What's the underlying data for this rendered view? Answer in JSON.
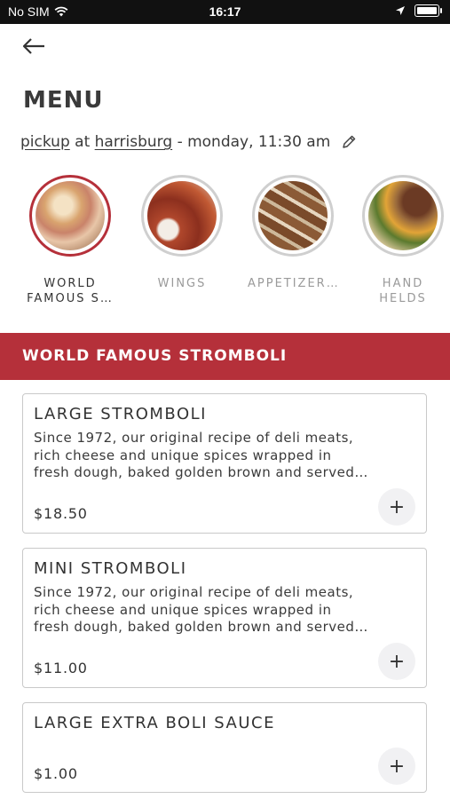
{
  "status_bar": {
    "carrier": "No SIM",
    "time": "16:17"
  },
  "page": {
    "title": "MENU"
  },
  "order": {
    "mode": "pickup",
    "at": "at",
    "location": "harrisburg",
    "time": "- monday, 11:30 am"
  },
  "categories": [
    {
      "label": "WORLD FAMOUS S…",
      "label_lines": [
        "WORLD",
        "FAMOUS S…"
      ],
      "active": true
    },
    {
      "label": "WINGS",
      "label_lines": [
        "WINGS"
      ],
      "active": false
    },
    {
      "label": "APPETIZER…",
      "label_lines": [
        "APPETIZER…"
      ],
      "active": false
    },
    {
      "label": "HAND HELDS",
      "label_lines": [
        "HAND",
        "HELDS"
      ],
      "active": false
    }
  ],
  "section": {
    "title": "WORLD FAMOUS STROMBOLI"
  },
  "items": [
    {
      "name": "LARGE STROMBOLI",
      "desc_lines": [
        "Since 1972, our original recipe of deli meats,",
        "rich cheese and unique spices wrapped in",
        "fresh dough, baked golden brown and served…"
      ],
      "price": "$18.50",
      "add": "+"
    },
    {
      "name": "MINI STROMBOLI",
      "desc_lines": [
        "Since 1972, our original recipe of deli meats,",
        "rich cheese and unique spices wrapped in",
        "fresh dough, baked golden brown and served…"
      ],
      "price": "$11.00",
      "add": "+"
    },
    {
      "name": "LARGE EXTRA BOLI SAUCE",
      "desc_lines": [],
      "price": "$1.00",
      "add": "+"
    }
  ],
  "colors": {
    "accent": "#b5303a",
    "text": "#3a3a3a",
    "muted": "#9a9a9a"
  }
}
